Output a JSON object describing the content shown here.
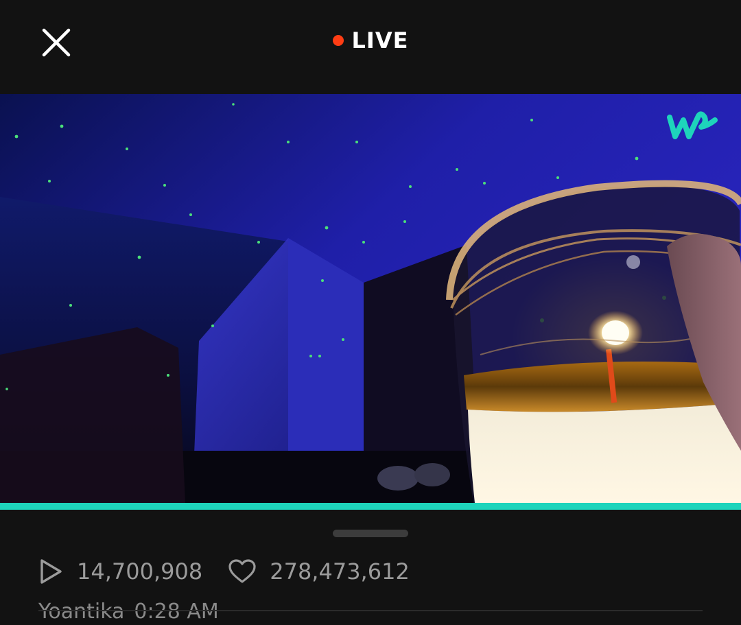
{
  "header": {
    "close_icon": "close-icon",
    "live_label": "LIVE",
    "live_dot_color": "#ff3d14"
  },
  "video": {
    "logo_icon": "weverse-logo-icon",
    "logo_color": "#1ed4bb",
    "progress_fraction": 1.0,
    "progress_color": "#1ed4bb"
  },
  "stats": {
    "play_icon": "play-icon",
    "plays": "14,700,908",
    "heart_icon": "heart-icon",
    "likes": "278,473,612"
  },
  "comment": {
    "author": "Yoantika",
    "time": "0:28 AM"
  }
}
